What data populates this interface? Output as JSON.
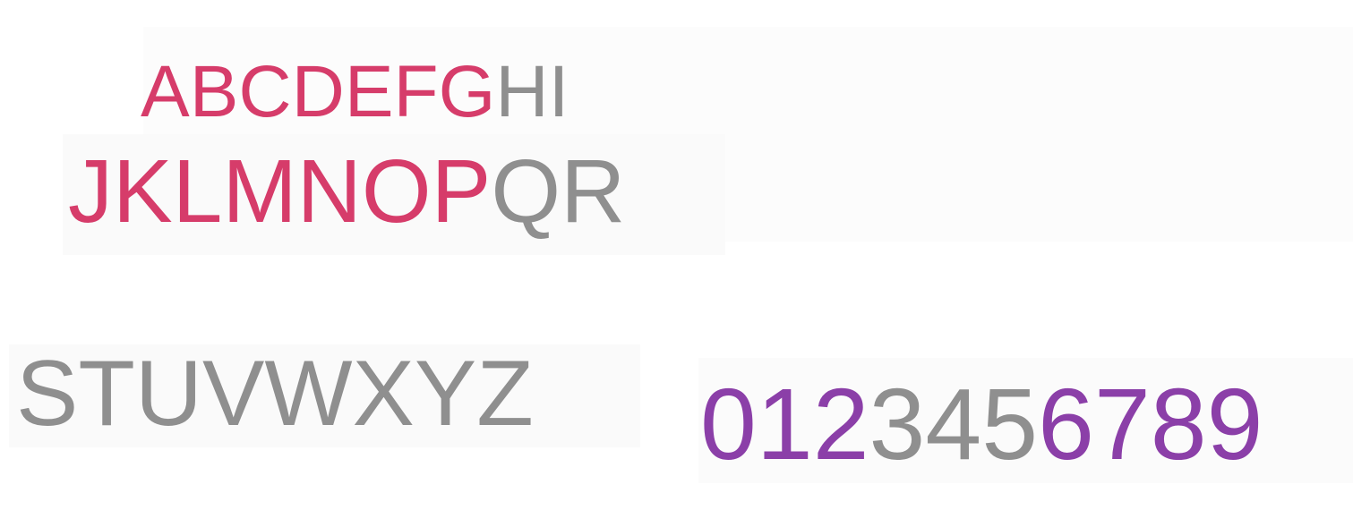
{
  "colors": {
    "accent_pink": "#d63c6a",
    "accent_purple": "#8b3fa8",
    "muted_gray": "#8f8f8f"
  },
  "lines": {
    "row1": {
      "highlighted": "ABCDEFG",
      "rest": "HI"
    },
    "row2": {
      "highlighted": "JKLMNOP",
      "rest": "QR"
    },
    "row3": {
      "text": "STUVWXYZ"
    },
    "digits": {
      "part1": "012",
      "part2": "345",
      "part3": "6789"
    }
  }
}
